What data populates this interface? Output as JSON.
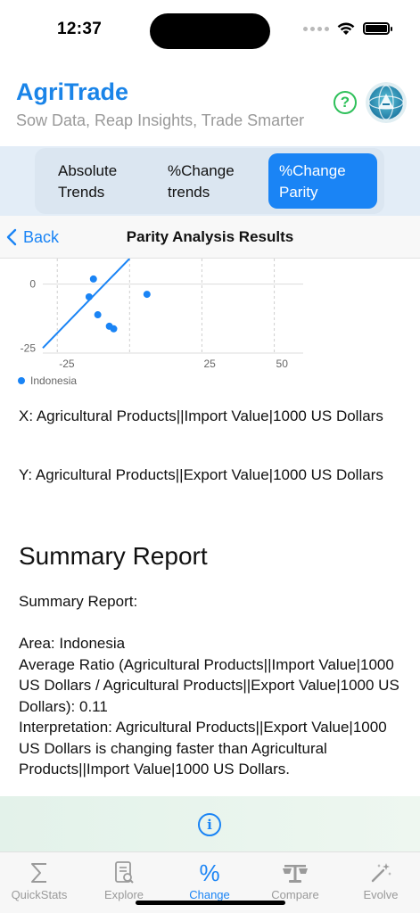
{
  "status_bar": {
    "time": "12:37"
  },
  "header": {
    "title": "AgriTrade",
    "subtitle": "Sow Data, Reap Insights, Trade Smarter",
    "help_glyph": "?",
    "icons": {
      "help": "question-circle-icon",
      "logo": "agritrade-globe-logo"
    }
  },
  "segments": [
    {
      "label": "Absolute Trends",
      "selected": false
    },
    {
      "label": "%Change trends",
      "selected": false
    },
    {
      "label": "%Change Parity",
      "selected": true
    }
  ],
  "nav": {
    "back_label": "Back",
    "title": "Parity Analysis Results"
  },
  "chart_data": {
    "type": "scatter",
    "x_ticks": [
      "-25",
      "25",
      "50"
    ],
    "y_ticks": [
      "0",
      "-25"
    ],
    "xlim": [
      -30,
      60
    ],
    "ylim": [
      -27,
      10
    ],
    "series": [
      {
        "name": "Indonesia",
        "color": "#1a84f5",
        "points": [
          {
            "x": -12.5,
            "y": 2
          },
          {
            "x": -14,
            "y": -5
          },
          {
            "x": -11,
            "y": -12
          },
          {
            "x": -7,
            "y": -16.5
          },
          {
            "x": -5.5,
            "y": -17.5
          },
          {
            "x": 6,
            "y": -4
          }
        ]
      }
    ],
    "reference_line": {
      "from": {
        "x": -30,
        "y": -25
      },
      "to": {
        "x": 0,
        "y": 10
      }
    },
    "legend": "bottom-left",
    "grid": true
  },
  "content": {
    "x_description": "X: Agricultural Products||Import Value|1000 US Dollars",
    "y_description": "Y: Agricultural Products||Export Value|1000 US Dollars",
    "summary_heading": "Summary Report",
    "summary_body": "Summary Report:\n\nArea: Indonesia\nAverage Ratio (Agricultural Products||Import Value|1000 US Dollars / Agricultural Products||Export Value|1000 US Dollars): 0.11\nInterpretation: Agricultural Products||Export Value|1000 US Dollars is changing faster than Agricultural Products||Import Value|1000 US Dollars."
  },
  "info_band": {
    "icon": "info-circle-icon",
    "glyph": "i"
  },
  "tabs": [
    {
      "label": "QuickStats",
      "icon": "sigma-icon",
      "active": false
    },
    {
      "label": "Explore",
      "icon": "document-search-icon",
      "active": false
    },
    {
      "label": "Change",
      "icon": "percent-icon",
      "active": true
    },
    {
      "label": "Compare",
      "icon": "scale-icon",
      "active": false
    },
    {
      "label": "Evolve",
      "icon": "magic-wand-icon",
      "active": false
    }
  ],
  "colors": {
    "accent": "#1a84f5",
    "help": "#2ec05a",
    "title": "#1a84e8"
  }
}
